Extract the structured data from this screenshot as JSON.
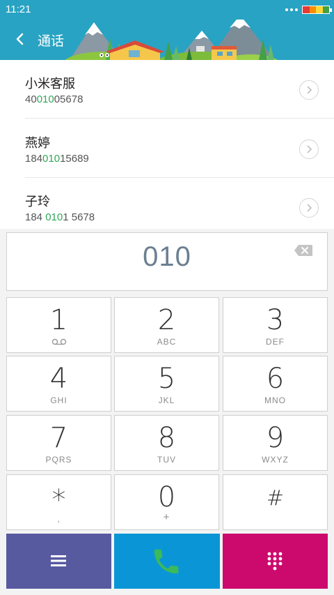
{
  "status_bar": {
    "time": "11:21",
    "signal_icon": "dots-icon",
    "battery_colors": [
      "#e53935",
      "#fb8c00",
      "#fdd835",
      "#43a047"
    ]
  },
  "header": {
    "title": "通话",
    "back_icon": "chevron-left-icon",
    "background": "#29a3c3"
  },
  "contacts": [
    {
      "name": "小米客服",
      "number_parts": [
        "40",
        "010",
        "05678"
      ]
    },
    {
      "name": "燕婷",
      "number_parts": [
        "184",
        "010",
        "15689"
      ]
    },
    {
      "name": "子玲",
      "number_parts": [
        "184 ",
        "010",
        "1 5678"
      ]
    }
  ],
  "dialer": {
    "input_value": "010",
    "backspace_icon": "backspace-icon"
  },
  "keypad": [
    {
      "digit": "1",
      "letters": "",
      "sub_icon": "voicemail-icon"
    },
    {
      "digit": "2",
      "letters": "ABC"
    },
    {
      "digit": "3",
      "letters": "DEF"
    },
    {
      "digit": "4",
      "letters": "GHI"
    },
    {
      "digit": "5",
      "letters": "JKL"
    },
    {
      "digit": "6",
      "letters": "MNO"
    },
    {
      "digit": "7",
      "letters": "PQRS"
    },
    {
      "digit": "8",
      "letters": "TUV"
    },
    {
      "digit": "9",
      "letters": "WXYZ"
    },
    {
      "digit": "*",
      "letters": ","
    },
    {
      "digit": "0",
      "letters": "+"
    },
    {
      "digit": "#",
      "letters": ""
    }
  ],
  "bottom_bar": {
    "menu": {
      "icon": "menu-icon",
      "color": "#585aa0"
    },
    "call": {
      "icon": "phone-icon",
      "color": "#0a96d6",
      "icon_color": "#3cb95a"
    },
    "keypad_toggle": {
      "icon": "dialpad-icon",
      "color": "#cc0a6e"
    }
  },
  "accent_highlight": "#2fa858"
}
